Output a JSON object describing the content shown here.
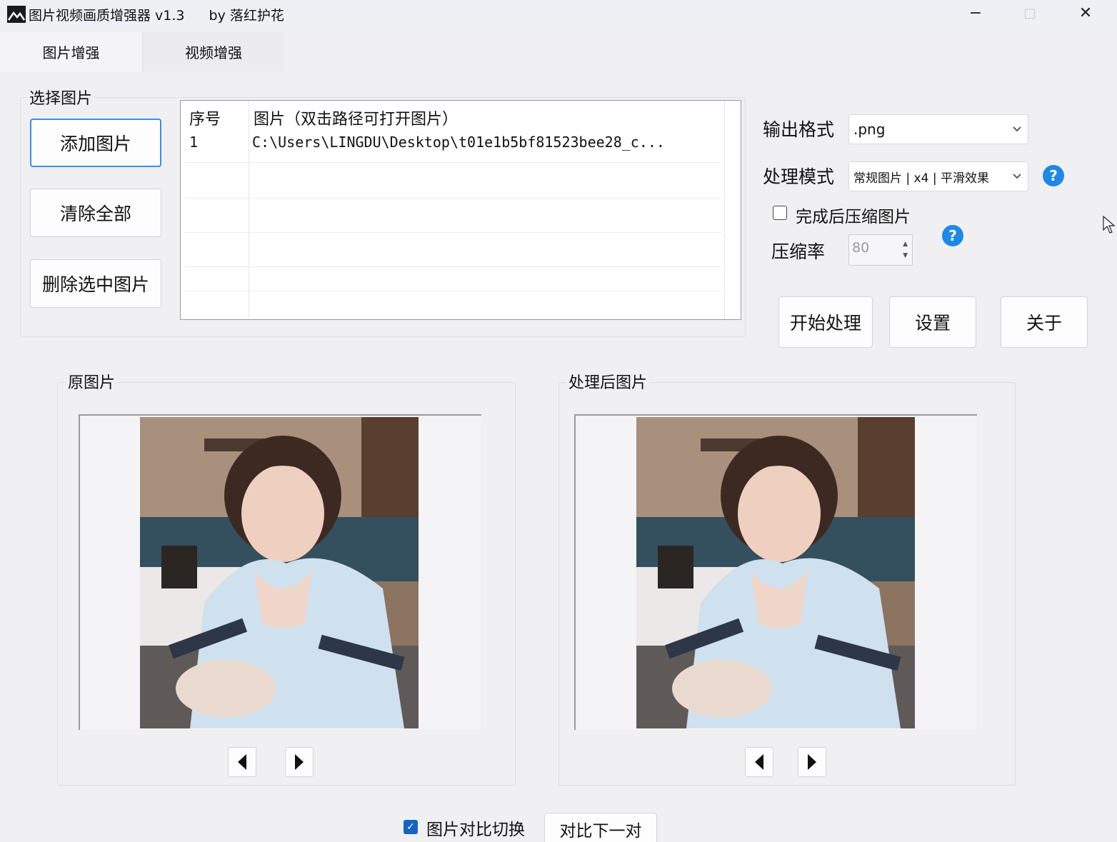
{
  "window": {
    "title": "图片视频画质增强器 v1.3",
    "author": "by 落红护花",
    "controls": {
      "minimize": "−",
      "maximize": "□",
      "close": "✕"
    }
  },
  "tabs": [
    {
      "label": "图片增强",
      "active": true
    },
    {
      "label": "视频增强",
      "active": false
    }
  ],
  "select_group": {
    "title": "选择图片",
    "add_button": "添加图片",
    "clear_button": "清除全部",
    "delete_button": "删除选中图片"
  },
  "file_list": {
    "columns": [
      "序号",
      "图片（双击路径可打开图片）"
    ],
    "rows": [
      {
        "index": "1",
        "path": "C:\\Users\\LINGDU\\Desktop\\t01e1b5bf81523bee28_c..."
      }
    ]
  },
  "options": {
    "output_format_label": "输出格式",
    "output_format_value": ".png",
    "mode_label": "处理模式",
    "mode_value": "常规图片 | x4 | 平滑效果",
    "compress_label": "完成后压缩图片",
    "compress_checked": false,
    "ratio_label": "压缩率",
    "ratio_value": "80",
    "help_icon": "?"
  },
  "actions": {
    "start": "开始处理",
    "settings": "设置",
    "about": "关于"
  },
  "original_group": {
    "title": "原图片"
  },
  "processed_group": {
    "title": "处理后图片"
  },
  "footer": {
    "compare_label": "图片对比切换",
    "compare_checked": true,
    "next_pair_button": "对比下一对"
  },
  "colors": {
    "accent": "#1e88e5",
    "focus_border": "#3a8ee6",
    "window_bg": "#f0f0f2"
  },
  "icons": [
    "app-icon",
    "chevron-down-icon",
    "help-icon",
    "arrow-left-icon",
    "arrow-right-icon",
    "checkmark-icon",
    "cursor-icon"
  ]
}
